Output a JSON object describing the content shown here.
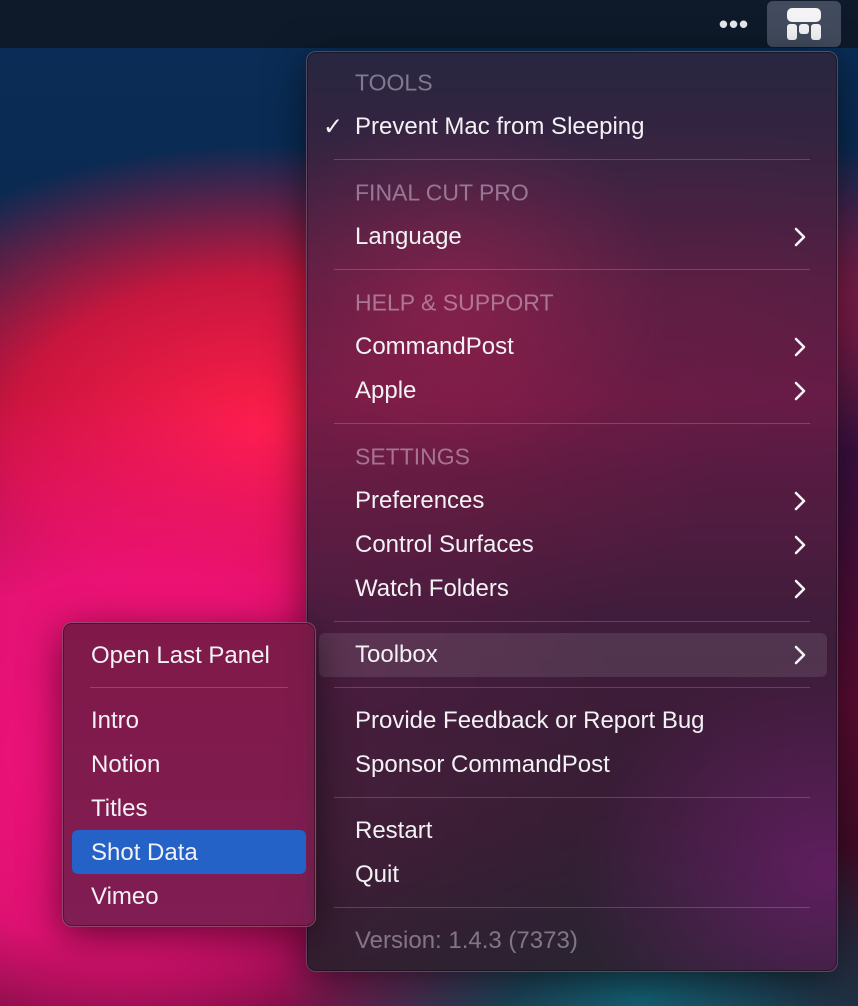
{
  "menubar": {
    "more_icon": "ellipsis-icon",
    "app_icon": "commandpost-icon",
    "more_glyph": "•••"
  },
  "main_menu": {
    "tools_header": "TOOLS",
    "prevent_sleep": {
      "label": "Prevent Mac from Sleeping",
      "checked": true,
      "check_glyph": "✓"
    },
    "fcp_header": "FINAL CUT PRO",
    "language": "Language",
    "help_header": "HELP & SUPPORT",
    "commandpost": "CommandPost",
    "apple": "Apple",
    "settings_header": "SETTINGS",
    "preferences": "Preferences",
    "control_surfaces": "Control Surfaces",
    "watch_folders": "Watch Folders",
    "toolbox": "Toolbox",
    "feedback": "Provide Feedback or Report Bug",
    "sponsor": "Sponsor CommandPost",
    "restart": "Restart",
    "quit": "Quit",
    "version": "Version: 1.4.3 (7373)"
  },
  "toolbox_submenu": {
    "open_last_panel": "Open Last Panel",
    "items": [
      "Intro",
      "Notion",
      "Titles",
      "Shot Data",
      "Vimeo"
    ],
    "selected": "Shot Data"
  },
  "colors": {
    "highlight": "#2462c8",
    "menubar": "#0e1a2a"
  }
}
